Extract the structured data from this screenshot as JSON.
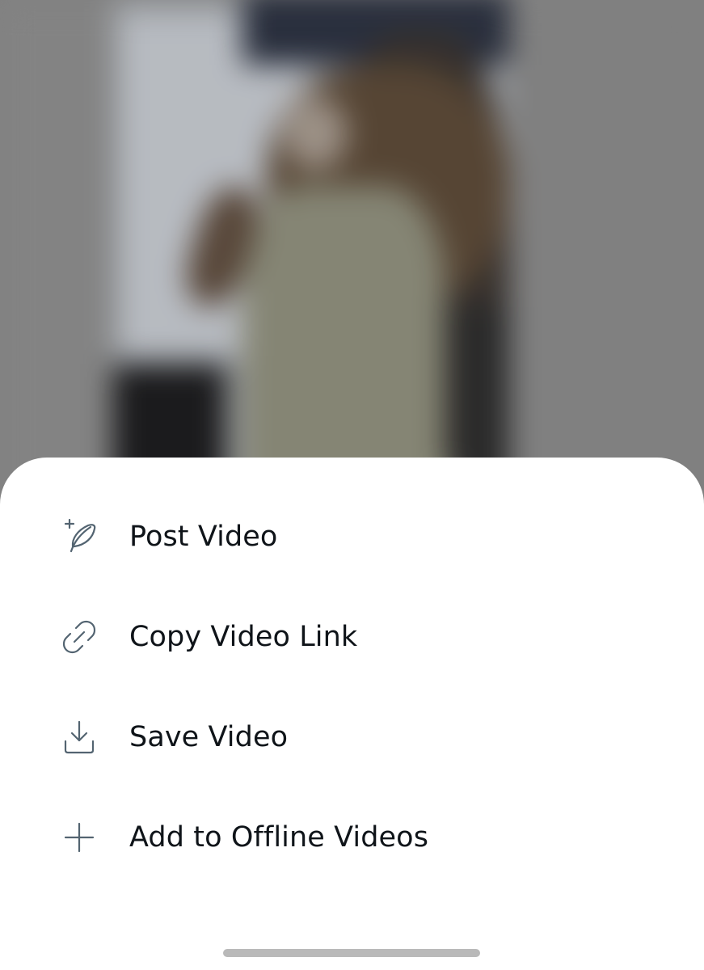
{
  "menu": {
    "items": [
      {
        "label": "Post Video",
        "icon": "post-feather-plus-icon"
      },
      {
        "label": "Copy Video Link",
        "icon": "link-icon"
      },
      {
        "label": "Save Video",
        "icon": "download-icon"
      },
      {
        "label": "Add to Offline Videos",
        "icon": "plus-icon"
      }
    ]
  },
  "colors": {
    "sheet_background": "#ffffff",
    "label_text": "#0f1419",
    "icon_stroke": "#536471",
    "backdrop_dim": "#8a8a8a",
    "home_indicator": "#b9b9b9"
  }
}
